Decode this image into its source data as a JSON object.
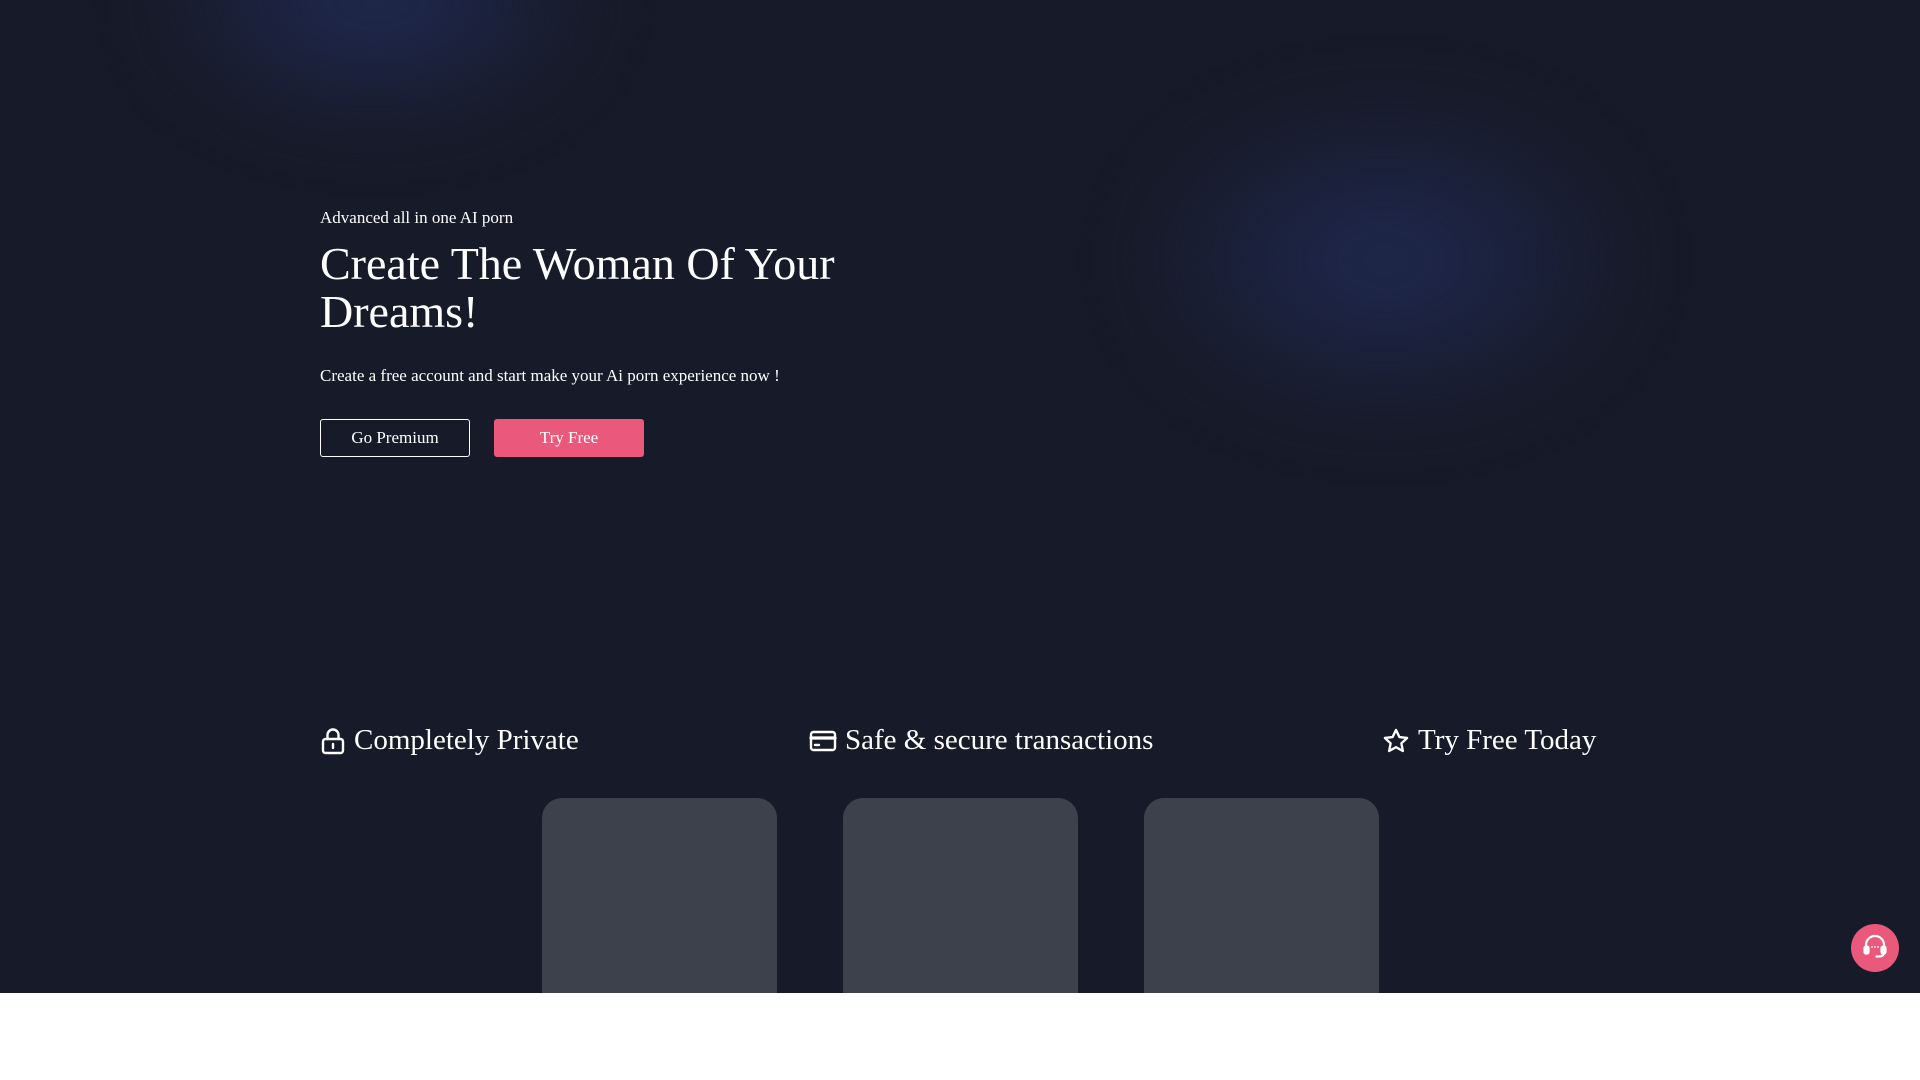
{
  "hero": {
    "eyebrow": "Advanced all in one AI porn",
    "title": "Create The Woman Of Your Dreams!",
    "subtitle": "Create a free account and start make your Ai porn experience now !",
    "buttons": {
      "premium_label": "Go Premium",
      "try_free_label": "Try Free"
    }
  },
  "features": [
    {
      "icon": "lock-icon",
      "label": "Completely Private"
    },
    {
      "icon": "credit-card-icon",
      "label": "Safe & secure transactions"
    },
    {
      "icon": "star-icon",
      "label": "Try Free Today"
    }
  ],
  "cards": [
    {
      "state": "loading-placeholder"
    },
    {
      "state": "loading-placeholder"
    },
    {
      "state": "loading-placeholder"
    }
  ],
  "support_button": {
    "icon": "headset-icon"
  },
  "colors": {
    "background": "#171b29",
    "accent": "#ea587b",
    "card_placeholder": "#3d414b",
    "text": "#ffffff"
  }
}
